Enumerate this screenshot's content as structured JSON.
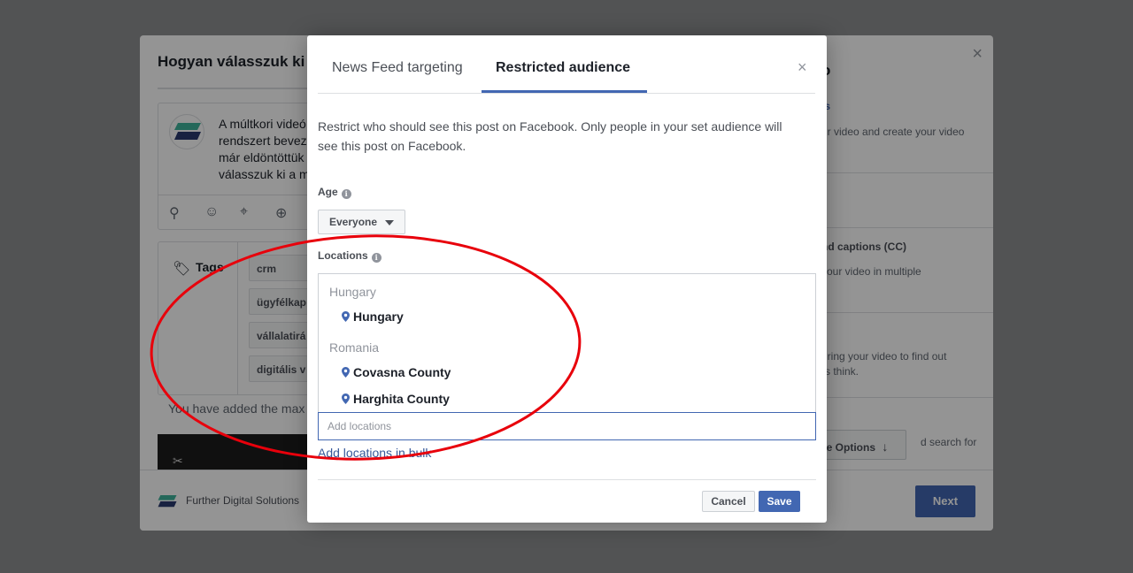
{
  "background": {
    "title": "Hogyan válasszuk ki",
    "composer_text": "A múltkori videó\nrendszert bevez\nmár eldöntöttük\nválasszuk ki a m",
    "tags_label": "Tags",
    "tags": [
      "crm",
      "ügyfélkap",
      "vállalatirá",
      "digitális v"
    ],
    "tag_remove_icon": "×",
    "max_note": "You have added the max",
    "page_name": "Further Digital Solutions",
    "next_label": "Next",
    "right_panel": {
      "heading_fragment": "o",
      "link_fragment": "ls",
      "text1": "ur video and create your video",
      "title2": "nd captions (CC)",
      "text2": "your video in multiple",
      "text3": "uring your video to find out\nrs think.",
      "more_options_label": "re Options",
      "more_options_icon": "↓",
      "text4": "d search for"
    }
  },
  "modal": {
    "tabs": [
      {
        "label": "News Feed targeting",
        "active": false
      },
      {
        "label": "Restricted audience",
        "active": true
      }
    ],
    "close_label": "×",
    "description": "Restrict who should see this post on Facebook. Only people in your set audience will see this post on Facebook.",
    "age_label": "Age",
    "age_value": "Everyone",
    "locations_label": "Locations",
    "info_glyph": "i",
    "location_groups": [
      {
        "country": "Hungary",
        "items": [
          "Hungary"
        ]
      },
      {
        "country": "Romania",
        "items": [
          "Covasna County",
          "Harghita County"
        ]
      }
    ],
    "add_locations_placeholder": "Add locations",
    "bulk_link": "Add locations in bulk",
    "cancel_label": "Cancel",
    "save_label": "Save"
  },
  "colors": {
    "accent": "#4267b2",
    "annotation": "#e8000b",
    "overlay": "#8e8f91"
  },
  "icons": {
    "location_pin": "map-pin-icon",
    "info": "info-icon",
    "dropdown": "caret-down-icon",
    "close": "close-icon"
  }
}
